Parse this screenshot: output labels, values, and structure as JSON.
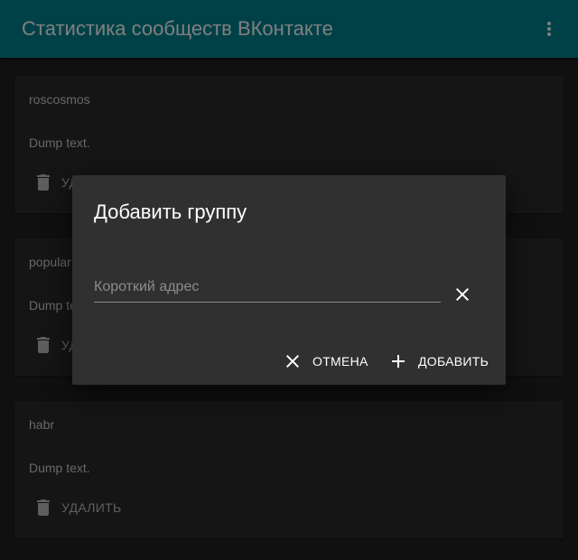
{
  "appbar": {
    "title": "Статистика сообществ ВКонтакте",
    "menu_icon": "more-vert-icon",
    "color": "#00838f"
  },
  "cards": [
    {
      "title": "roscosmos",
      "text": "Dump text.",
      "delete_label": "УДАЛИТЬ"
    },
    {
      "title": "popular",
      "text": "Dump text.",
      "delete_label": "УДАЛИТЬ"
    },
    {
      "title": "habr",
      "text": "Dump text.",
      "delete_label": "УДАЛИТЬ"
    }
  ],
  "dialog": {
    "title": "Добавить группу",
    "input": {
      "value": "",
      "placeholder": "Короткий адрес"
    },
    "clear_icon": "close-icon",
    "cancel_label": "ОТМЕНА",
    "add_label": "ДОБАВИТЬ"
  },
  "colors": {
    "background": "#212121",
    "card": "#2a2a2a",
    "dialog": "#303030"
  }
}
